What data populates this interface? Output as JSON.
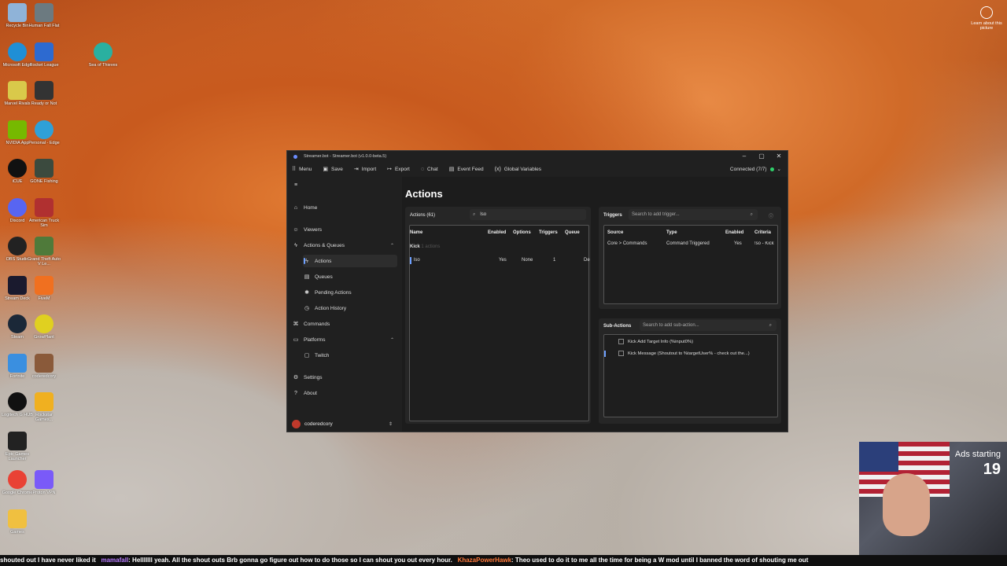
{
  "desktop": {
    "icons_col1": [
      "Recycle Bin",
      "Microsoft Edge",
      "Marvel Rivals",
      "NVIDIA App",
      "iCUE",
      "Discord",
      "OBS Studio",
      "Stream Deck",
      "Steam",
      "Fortnite",
      "Logitech G HUB",
      "Epic Games Launcher",
      "Google Chrome",
      "Games"
    ],
    "icons_col2": [
      "Human Fall Flat",
      "Rocket League",
      "Ready or Not",
      "Personal - Edge",
      "GONE Fishing",
      "American Truck Sim",
      "Grand Theft Auto V Le...",
      "FiveM",
      "GrowPlant",
      "coderedcory",
      "Rockstar Games...",
      "Proton VPN"
    ],
    "icons_col3": [
      "Sea of Thieves"
    ],
    "learn_label": "Learn about this picture"
  },
  "window": {
    "title": "Streamer.bot - Streamer.bot (v1.0.0-beta.5)",
    "toolbar": {
      "menu": "Menu",
      "save": "Save",
      "import": "Import",
      "export": "Export",
      "chat": "Chat",
      "event_feed": "Event Feed",
      "global_variables": "Global Variables",
      "connected": "Connected (7/7)"
    },
    "sidebar": {
      "home": "Home",
      "viewers": "Viewers",
      "actions_queues": "Actions & Queues",
      "actions": "Actions",
      "queues": "Queues",
      "pending_actions": "Pending Actions",
      "action_history": "Action History",
      "commands": "Commands",
      "platforms": "Platforms",
      "twitch": "Twitch",
      "settings": "Settings",
      "about": "About",
      "user": "coderedcory"
    },
    "page_title": "Actions",
    "actions_panel": {
      "header": "Actions (61)",
      "search_value": "lso",
      "columns": [
        "Name",
        "Enabled",
        "Options",
        "Triggers",
        "Queue"
      ],
      "group": "Kick",
      "group_hint": "1 actions",
      "rows": [
        {
          "name": "lso",
          "enabled": "Yes",
          "options": "None",
          "triggers": "1",
          "queue": "De"
        }
      ]
    },
    "triggers_panel": {
      "header": "Triggers",
      "search_placeholder": "Search to add trigger...",
      "columns": [
        "Source",
        "Type",
        "Enabled",
        "Criteria"
      ],
      "rows": [
        {
          "source": "Core > Commands",
          "type": "Command Triggered",
          "enabled": "Yes",
          "criteria": "!so - Kick"
        }
      ]
    },
    "subactions_panel": {
      "header": "Sub-Actions",
      "search_placeholder": "Search to add sub-action...",
      "items": [
        "Kick Add Target Info (%input0%)",
        "Kick Message (Shoutout to %targetUser% - check out the...)"
      ]
    }
  },
  "ticker": {
    "text_before": "shouted out  I have never liked it",
    "user1": "mamafall",
    "msg1": ": Helllllll yeah. All the shout outs  Brb gonna go figure out how to do those so I can shout you out every hour.",
    "user2": "KhazaPowerHawk",
    "msg2": ": Theo used to do it to me all the time for being a W mod until I banned the word of shouting me out"
  },
  "overlay": {
    "ads_label": "Ads starting",
    "ads_count": "19"
  },
  "colors": {
    "accent": "#6ea0ff",
    "status_green": "#2fd06b",
    "window_bg": "#202020"
  }
}
